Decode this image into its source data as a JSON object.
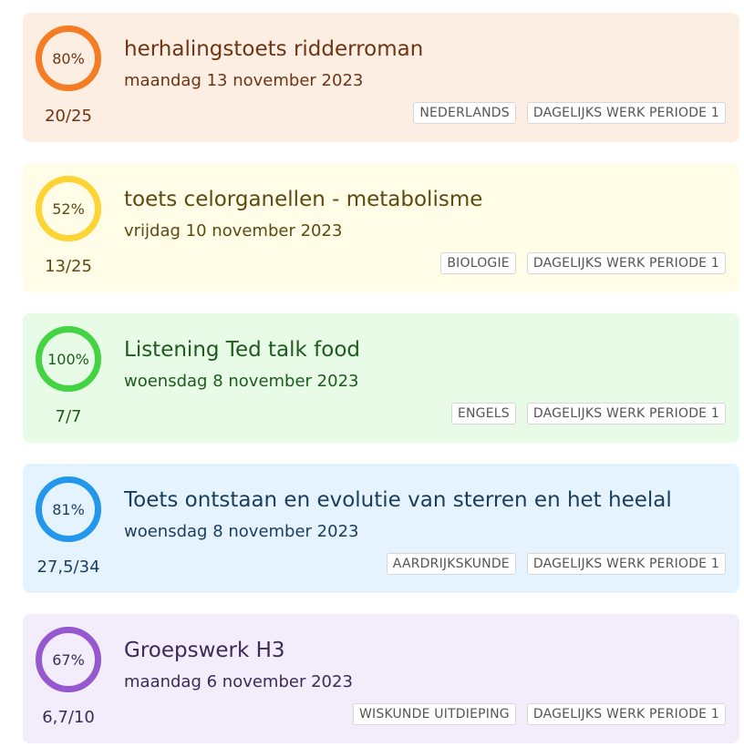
{
  "cards": [
    {
      "percent": "80%",
      "score": "20/25",
      "title": "herhalingstoets ridderroman",
      "date": "maandag 13 november 2023",
      "tags": [
        "NEDERLANDS",
        "DAGELIJKS WERK PERIODE 1"
      ],
      "colors": {
        "bg": "#fdeee4",
        "ring": "#f57c22",
        "text": "#6e3413"
      }
    },
    {
      "percent": "52%",
      "score": "13/25",
      "title": "toets celorganellen - metabolisme",
      "date": "vrijdag 10 november 2023",
      "tags": [
        "BIOLOGIE",
        "DAGELIJKS WERK PERIODE 1"
      ],
      "colors": {
        "bg": "#fffce7",
        "ring": "#fcd434",
        "text": "#5c4a12"
      }
    },
    {
      "percent": "100%",
      "score": "7/7",
      "title": "Listening Ted talk food",
      "date": "woensdag 8 november 2023",
      "tags": [
        "ENGELS",
        "DAGELIJKS WERK PERIODE 1"
      ],
      "colors": {
        "bg": "#e7fbe6",
        "ring": "#43d343",
        "text": "#1f5a1f"
      }
    },
    {
      "percent": "81%",
      "score": "27,5/34",
      "title": "Toets ontstaan en evolutie van sterren en het heelal",
      "date": "woensdag 8 november 2023",
      "tags": [
        "AARDRIJKSKUNDE",
        "DAGELIJKS WERK PERIODE 1"
      ],
      "colors": {
        "bg": "#e5f3fe",
        "ring": "#2397ec",
        "text": "#1b3d5c"
      }
    },
    {
      "percent": "67%",
      "score": "6,7/10",
      "title": "Groepswerk H3",
      "date": "maandag 6 november 2023",
      "tags": [
        "WISKUNDE UITDIEPING",
        "DAGELIJKS WERK PERIODE 1"
      ],
      "colors": {
        "bg": "#f2ecfb",
        "ring": "#9558cf",
        "text": "#3c2b55"
      }
    }
  ]
}
